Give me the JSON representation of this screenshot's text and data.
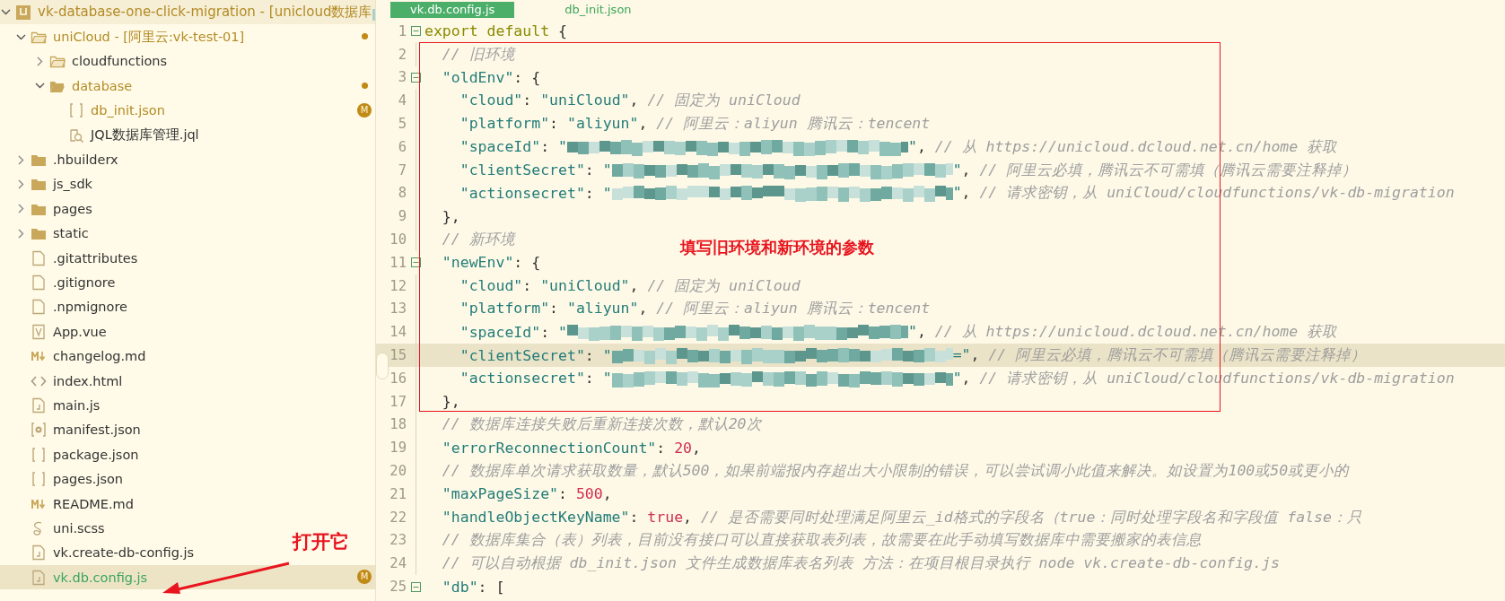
{
  "tree": [
    {
      "label": "vk-database-one-click-migration - [unicloud数据库",
      "kind": "project",
      "expanded": true,
      "selected": false,
      "color": "#b38b26",
      "redacted_tail": true,
      "children": [
        {
          "label": "uniCloud - [阿里云:vk-test-01]",
          "kind": "cloud-folder",
          "expanded": true,
          "selected": false,
          "color": "#b38b26",
          "modified": true,
          "children": [
            {
              "label": "cloudfunctions",
              "kind": "cloud-folder",
              "expanded": false,
              "selected": false,
              "color": "#333333"
            },
            {
              "label": "database",
              "kind": "folder-open",
              "expanded": true,
              "selected": false,
              "color": "#b38b26",
              "modified": true,
              "children": [
                {
                  "label": "db_init.json",
                  "kind": "json",
                  "selected": false,
                  "color": "#b38b26",
                  "badge": "M"
                },
                {
                  "label": "JQL数据库管理.jql",
                  "kind": "jql",
                  "selected": false,
                  "color": "#333333"
                }
              ]
            }
          ]
        },
        {
          "label": ".hbuilderx",
          "kind": "folder",
          "expanded": false,
          "selected": false,
          "color": "#333333"
        },
        {
          "label": "js_sdk",
          "kind": "folder",
          "expanded": false,
          "selected": false,
          "color": "#333333"
        },
        {
          "label": "pages",
          "kind": "folder",
          "expanded": false,
          "selected": false,
          "color": "#333333"
        },
        {
          "label": "static",
          "kind": "folder",
          "expanded": false,
          "selected": false,
          "color": "#333333"
        },
        {
          "label": ".gitattributes",
          "kind": "file",
          "selected": false,
          "color": "#333333"
        },
        {
          "label": ".gitignore",
          "kind": "file",
          "selected": false,
          "color": "#333333"
        },
        {
          "label": ".npmignore",
          "kind": "file",
          "selected": false,
          "color": "#333333"
        },
        {
          "label": "App.vue",
          "kind": "vue",
          "selected": false,
          "color": "#333333"
        },
        {
          "label": "changelog.md",
          "kind": "markdown",
          "selected": false,
          "color": "#333333"
        },
        {
          "label": "index.html",
          "kind": "html",
          "selected": false,
          "color": "#333333"
        },
        {
          "label": "main.js",
          "kind": "js",
          "selected": false,
          "color": "#333333"
        },
        {
          "label": "manifest.json",
          "kind": "json-gear",
          "selected": false,
          "color": "#333333"
        },
        {
          "label": "package.json",
          "kind": "json",
          "selected": false,
          "color": "#333333"
        },
        {
          "label": "pages.json",
          "kind": "json",
          "selected": false,
          "color": "#333333"
        },
        {
          "label": "README.md",
          "kind": "markdown",
          "selected": false,
          "color": "#333333"
        },
        {
          "label": "uni.scss",
          "kind": "sass",
          "selected": false,
          "color": "#333333"
        },
        {
          "label": "vk.create-db-config.js",
          "kind": "js",
          "selected": false,
          "color": "#333333"
        },
        {
          "label": "vk.db.config.js",
          "kind": "js",
          "selected": true,
          "color": "#3ca65a",
          "badge": "M"
        }
      ]
    }
  ],
  "editor": {
    "tabs": [
      {
        "label": "vk.db.config.js",
        "selected": true
      },
      {
        "label": "db_init.json",
        "selected": false
      }
    ],
    "lines": [
      {
        "number": "1",
        "fold": true,
        "current": false,
        "parts": [
          {
            "kind": "code",
            "tokens": [
              {
                "kind": "kw",
                "text": "export default"
              },
              {
                "kind": "punc",
                "text": " {"
              }
            ]
          }
        ]
      },
      {
        "number": "2",
        "fold": false,
        "current": false,
        "parts": [
          {
            "kind": "code",
            "tokens": [
              {
                "kind": "cm",
                "text": "  // 旧环境"
              }
            ]
          }
        ]
      },
      {
        "number": "3",
        "fold": true,
        "current": false,
        "parts": [
          {
            "kind": "code",
            "tokens": [
              {
                "kind": "key",
                "text": "  \"oldEnv\""
              },
              {
                "kind": "punc",
                "text": ": {"
              }
            ]
          }
        ]
      },
      {
        "number": "4",
        "fold": false,
        "current": false,
        "parts": [
          {
            "kind": "code",
            "tokens": [
              {
                "kind": "key",
                "text": "    \"cloud\""
              },
              {
                "kind": "punc",
                "text": ": "
              },
              {
                "kind": "str",
                "text": "\"uniCloud\""
              },
              {
                "kind": "punc",
                "text": ", "
              },
              {
                "kind": "cm",
                "text": "// 固定为 uniCloud"
              }
            ]
          }
        ]
      },
      {
        "number": "5",
        "fold": false,
        "current": false,
        "parts": [
          {
            "kind": "code",
            "tokens": [
              {
                "kind": "key",
                "text": "    \"platform\""
              },
              {
                "kind": "punc",
                "text": ": "
              },
              {
                "kind": "str",
                "text": "\"aliyun\""
              },
              {
                "kind": "punc",
                "text": ", "
              },
              {
                "kind": "cm",
                "text": "// 阿里云：aliyun 腾讯云：tencent"
              }
            ]
          }
        ]
      },
      {
        "number": "6",
        "fold": false,
        "current": false,
        "parts": [
          {
            "kind": "code",
            "tokens": [
              {
                "kind": "key",
                "text": "    \"spaceId\""
              },
              {
                "kind": "punc",
                "text": ": "
              },
              {
                "kind": "str",
                "text": "\""
              }
            ]
          },
          {
            "kind": "redacted"
          },
          {
            "kind": "code",
            "tokens": [
              {
                "kind": "str",
                "text": "\""
              },
              {
                "kind": "punc",
                "text": ", "
              },
              {
                "kind": "cm",
                "text": "// 从 https://unicloud.dcloud.net.cn/home 获取"
              }
            ]
          }
        ]
      },
      {
        "number": "7",
        "fold": false,
        "current": false,
        "parts": [
          {
            "kind": "code",
            "tokens": [
              {
                "kind": "key",
                "text": "    \"clientSecret\""
              },
              {
                "kind": "punc",
                "text": ": "
              },
              {
                "kind": "str",
                "text": "\""
              }
            ]
          },
          {
            "kind": "redacted"
          },
          {
            "kind": "code",
            "tokens": [
              {
                "kind": "str",
                "text": "\""
              },
              {
                "kind": "punc",
                "text": ", "
              },
              {
                "kind": "cm",
                "text": "// 阿里云必填，腾讯云不可需填（腾讯云需要注释掉）"
              }
            ]
          }
        ]
      },
      {
        "number": "8",
        "fold": false,
        "current": false,
        "parts": [
          {
            "kind": "code",
            "tokens": [
              {
                "kind": "key",
                "text": "    \"actionsecret\""
              },
              {
                "kind": "punc",
                "text": ": "
              },
              {
                "kind": "str",
                "text": "\""
              }
            ]
          },
          {
            "kind": "redacted"
          },
          {
            "kind": "code",
            "tokens": [
              {
                "kind": "str",
                "text": "\""
              },
              {
                "kind": "punc",
                "text": ", "
              },
              {
                "kind": "cm",
                "text": "// 请求密钥，从 uniCloud/cloudfunctions/vk-db-migration"
              }
            ]
          }
        ]
      },
      {
        "number": "9",
        "fold": false,
        "current": false,
        "parts": [
          {
            "kind": "code",
            "tokens": [
              {
                "kind": "punc",
                "text": "  },"
              }
            ]
          }
        ]
      },
      {
        "number": "10",
        "fold": false,
        "current": false,
        "parts": [
          {
            "kind": "code",
            "tokens": [
              {
                "kind": "cm",
                "text": "  // 新环境"
              }
            ]
          }
        ]
      },
      {
        "number": "11",
        "fold": true,
        "current": false,
        "parts": [
          {
            "kind": "code",
            "tokens": [
              {
                "kind": "key",
                "text": "  \"newEnv\""
              },
              {
                "kind": "punc",
                "text": ": {"
              }
            ]
          }
        ]
      },
      {
        "number": "12",
        "fold": false,
        "current": false,
        "parts": [
          {
            "kind": "code",
            "tokens": [
              {
                "kind": "key",
                "text": "    \"cloud\""
              },
              {
                "kind": "punc",
                "text": ": "
              },
              {
                "kind": "str",
                "text": "\"uniCloud\""
              },
              {
                "kind": "punc",
                "text": ", "
              },
              {
                "kind": "cm",
                "text": "// 固定为 uniCloud"
              }
            ]
          }
        ]
      },
      {
        "number": "13",
        "fold": false,
        "current": false,
        "parts": [
          {
            "kind": "code",
            "tokens": [
              {
                "kind": "key",
                "text": "    \"platform\""
              },
              {
                "kind": "punc",
                "text": ": "
              },
              {
                "kind": "str",
                "text": "\"aliyun\""
              },
              {
                "kind": "punc",
                "text": ", "
              },
              {
                "kind": "cm",
                "text": "// 阿里云：aliyun 腾讯云：tencent"
              }
            ]
          }
        ]
      },
      {
        "number": "14",
        "fold": false,
        "current": false,
        "parts": [
          {
            "kind": "code",
            "tokens": [
              {
                "kind": "key",
                "text": "    \"spaceId\""
              },
              {
                "kind": "punc",
                "text": ": "
              },
              {
                "kind": "str",
                "text": "\""
              }
            ]
          },
          {
            "kind": "redacted"
          },
          {
            "kind": "code",
            "tokens": [
              {
                "kind": "str",
                "text": "\""
              },
              {
                "kind": "punc",
                "text": ", "
              },
              {
                "kind": "cm",
                "text": "// 从 https://unicloud.dcloud.net.cn/home 获取"
              }
            ]
          }
        ]
      },
      {
        "number": "15",
        "fold": false,
        "current": true,
        "parts": [
          {
            "kind": "code",
            "tokens": [
              {
                "kind": "key",
                "text": "    \"clientSecret\""
              },
              {
                "kind": "punc",
                "text": ": "
              },
              {
                "kind": "str",
                "text": "\""
              }
            ]
          },
          {
            "kind": "redacted"
          },
          {
            "kind": "code",
            "tokens": [
              {
                "kind": "str",
                "text": "=\""
              },
              {
                "kind": "punc",
                "text": ", "
              },
              {
                "kind": "cm",
                "text": "// 阿里云必填，腾讯云不可需填（腾讯云需要注释掉）"
              }
            ]
          }
        ]
      },
      {
        "number": "16",
        "fold": false,
        "current": false,
        "parts": [
          {
            "kind": "code",
            "tokens": [
              {
                "kind": "key",
                "text": "    \"actionsecret\""
              },
              {
                "kind": "punc",
                "text": ": "
              },
              {
                "kind": "str",
                "text": "\""
              }
            ]
          },
          {
            "kind": "redacted"
          },
          {
            "kind": "code",
            "tokens": [
              {
                "kind": "str",
                "text": "\""
              },
              {
                "kind": "punc",
                "text": ", "
              },
              {
                "kind": "cm",
                "text": "// 请求密钥，从 uniCloud/cloudfunctions/vk-db-migration"
              }
            ]
          }
        ]
      },
      {
        "number": "17",
        "fold": false,
        "current": false,
        "parts": [
          {
            "kind": "code",
            "tokens": [
              {
                "kind": "punc",
                "text": "  },"
              }
            ]
          }
        ]
      },
      {
        "number": "18",
        "fold": false,
        "current": false,
        "parts": [
          {
            "kind": "code",
            "tokens": [
              {
                "kind": "cm",
                "text": "  // 数据库连接失败后重新连接次数，默认20次"
              }
            ]
          }
        ]
      },
      {
        "number": "19",
        "fold": false,
        "current": false,
        "parts": [
          {
            "kind": "code",
            "tokens": [
              {
                "kind": "key",
                "text": "  \"errorReconnectionCount\""
              },
              {
                "kind": "punc",
                "text": ": "
              },
              {
                "kind": "num",
                "text": "20"
              },
              {
                "kind": "punc",
                "text": ","
              }
            ]
          }
        ]
      },
      {
        "number": "20",
        "fold": false,
        "current": false,
        "parts": [
          {
            "kind": "code",
            "tokens": [
              {
                "kind": "cm",
                "text": "  // 数据库单次请求获取数量，默认500，如果前端报内存超出大小限制的错误，可以尝试调小此值来解决。如设置为100或50或更小的"
              }
            ]
          }
        ]
      },
      {
        "number": "21",
        "fold": false,
        "current": false,
        "parts": [
          {
            "kind": "code",
            "tokens": [
              {
                "kind": "key",
                "text": "  \"maxPageSize\""
              },
              {
                "kind": "punc",
                "text": ": "
              },
              {
                "kind": "num",
                "text": "500"
              },
              {
                "kind": "punc",
                "text": ","
              }
            ]
          }
        ]
      },
      {
        "number": "22",
        "fold": false,
        "current": false,
        "parts": [
          {
            "kind": "code",
            "tokens": [
              {
                "kind": "key",
                "text": "  \"handleObjectKeyName\""
              },
              {
                "kind": "punc",
                "text": ": "
              },
              {
                "kind": "num",
                "text": "true"
              },
              {
                "kind": "punc",
                "text": ", "
              },
              {
                "kind": "cm",
                "text": "// 是否需要同时处理满足阿里云_id格式的字段名（true：同时处理字段名和字段值 false：只"
              }
            ]
          }
        ]
      },
      {
        "number": "23",
        "fold": false,
        "current": false,
        "parts": [
          {
            "kind": "code",
            "tokens": [
              {
                "kind": "cm",
                "text": "  // 数据库集合（表）列表，目前没有接口可以直接获取表列表，故需要在此手动填写数据库中需要搬家的表信息"
              }
            ]
          }
        ]
      },
      {
        "number": "24",
        "fold": false,
        "current": false,
        "parts": [
          {
            "kind": "code",
            "tokens": [
              {
                "kind": "cm",
                "text": "  // 可以自动根据 db_init.json 文件生成数据库表名列表 方法：在项目根目录执行 node vk.create-db-config.js"
              }
            ]
          }
        ]
      },
      {
        "number": "25",
        "fold": true,
        "current": false,
        "parts": [
          {
            "kind": "code",
            "tokens": [
              {
                "kind": "key",
                "text": "  \"db\""
              },
              {
                "kind": "punc",
                "text": ": ["
              }
            ]
          }
        ]
      }
    ]
  },
  "annotations": {
    "box_note": "填写旧环境和新环境的参数",
    "arrow_note": "打开它"
  }
}
